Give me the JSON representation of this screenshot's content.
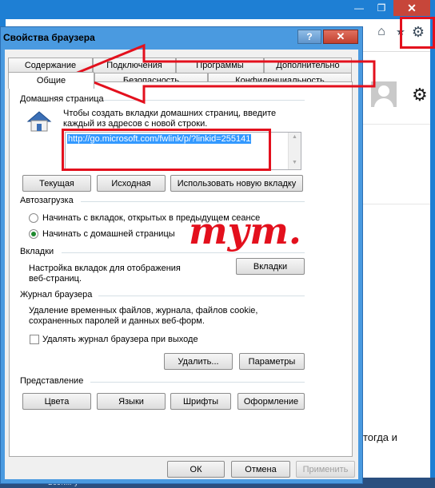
{
  "background_window": {
    "minimize_glyph": "—",
    "restore_glyph": "❐",
    "close_glyph": "✕",
    "toolbar_icons": [
      "home-icon",
      "star-icon",
      "gear-icon"
    ],
    "home_glyph": "⌂",
    "star_glyph": "★",
    "gear_glyph": "⚙",
    "content_gear_glyph": "⚙",
    "body_text": "тогда и",
    "taskbar_text": "Вести.Ру"
  },
  "dialog": {
    "title": "Свойства браузера",
    "help_label": "?",
    "close_label": "✕",
    "tabs_top": [
      "Содержание",
      "Подключения",
      "Программы",
      "Дополнительно"
    ],
    "tabs_bottom": [
      "Общие",
      "Безопасность",
      "Конфиденциальность"
    ],
    "active_tab": "Общие",
    "home_page": {
      "heading": "Домашняя страница",
      "description_line1": "Чтобы создать вкладки домашних страниц, введите",
      "description_line2": "каждый из адресов с новой строки.",
      "url_value": "http://go.microsoft.com/fwlink/p/?linkid=255141",
      "buttons": {
        "current": "Текущая",
        "default": "Исходная",
        "new_tab": "Использовать новую вкладку"
      }
    },
    "startup": {
      "heading": "Автозагрузка",
      "option_tabs": "Начинать с вкладок, открытых в предыдущем сеансе",
      "option_home": "Начинать с домашней страницы",
      "selected": "option_home"
    },
    "tabs_section": {
      "heading": "Вкладки",
      "description_line1": "Настройка вкладок для отображения",
      "description_line2": "веб-страниц.",
      "button": "Вкладки"
    },
    "history": {
      "heading": "Журнал браузера",
      "description_line1": "Удаление временных файлов, журнала, файлов cookie,",
      "description_line2": "сохраненных паролей и данных веб-форм.",
      "checkbox_label": "Удалять журнал браузера при выходе",
      "checkbox_checked": false,
      "delete_button": "Удалить...",
      "params_button": "Параметры"
    },
    "appearance": {
      "heading": "Представление",
      "buttons": [
        "Цвета",
        "Языки",
        "Шрифты",
        "Оформление"
      ]
    },
    "footer": {
      "ok": "ОК",
      "cancel": "Отмена",
      "apply": "Применить"
    }
  },
  "annotation": {
    "text": "тут.",
    "color": "#e3101d"
  },
  "colors": {
    "titlebar": "#1e7fd4",
    "dialog_frame": "#4a9ae0",
    "highlight_red": "#e3101d",
    "selection_blue": "#3399ff"
  }
}
